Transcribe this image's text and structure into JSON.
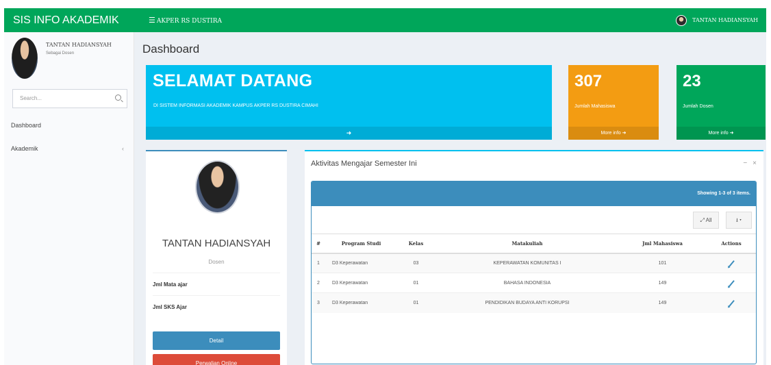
{
  "topbar": {
    "brand": "SIS INFO AKADEMIK",
    "institution": "AKPER RS DUSTIRA",
    "user_name": "TANTAN HADIANSYAH",
    "color": "#00a65a"
  },
  "sidebar": {
    "user_name": "TANTAN HADIANSYAH",
    "user_role": "Sebagai Dosen",
    "search_placeholder": "Search...",
    "items": [
      {
        "label": "Dashboard"
      },
      {
        "label": "Akademik",
        "chevron": "‹"
      }
    ]
  },
  "page": {
    "title": "Dashboard"
  },
  "welcome": {
    "title": "SELAMAT DATANG",
    "subtitle": "DI SISTEM INFORMASI AKADEMIK KAMPUS AKPER RS DUSTIRA CIMAHI",
    "footer_icon": "arrow-circle-right-icon",
    "color": "#00c0ef"
  },
  "stats": [
    {
      "value": "307",
      "label": "Jumlah Mahasiswa",
      "link": "More info",
      "color": "#f39c12"
    },
    {
      "value": "23",
      "label": "Jumlah Dosen",
      "link": "More info",
      "color": "#00a65a"
    }
  ],
  "profile": {
    "name": "TANTAN HADIANSYAH",
    "role": "Dosen",
    "rows": [
      {
        "label": "Jml Mata ajar"
      },
      {
        "label": "Jml SKS Ajar"
      }
    ],
    "detail_button": "Detail",
    "online_button": "Perwalian Online"
  },
  "activity": {
    "title": "Aktivitas Mengajar Semester Ini",
    "summary": "Showing 1-3 of 3 items.",
    "all_button": "All",
    "columns": [
      "#",
      "Program Studi",
      "Kelas",
      "Matakuliah",
      "Jml Mahasiswa",
      "Actions"
    ],
    "rows": [
      {
        "no": "1",
        "prodi": "D3 Keperawatan",
        "kelas": "03",
        "mk": "KEPERAWATAN KOMUNITAS I",
        "jml": "101"
      },
      {
        "no": "2",
        "prodi": "D3 Keperawatan",
        "kelas": "01",
        "mk": "BAHASA INDONESIA",
        "jml": "149"
      },
      {
        "no": "3",
        "prodi": "D3 Keperawatan",
        "kelas": "01",
        "mk": "PENDIDIKAN BUDAYA ANTI KORUPSI",
        "jml": "149"
      }
    ]
  }
}
